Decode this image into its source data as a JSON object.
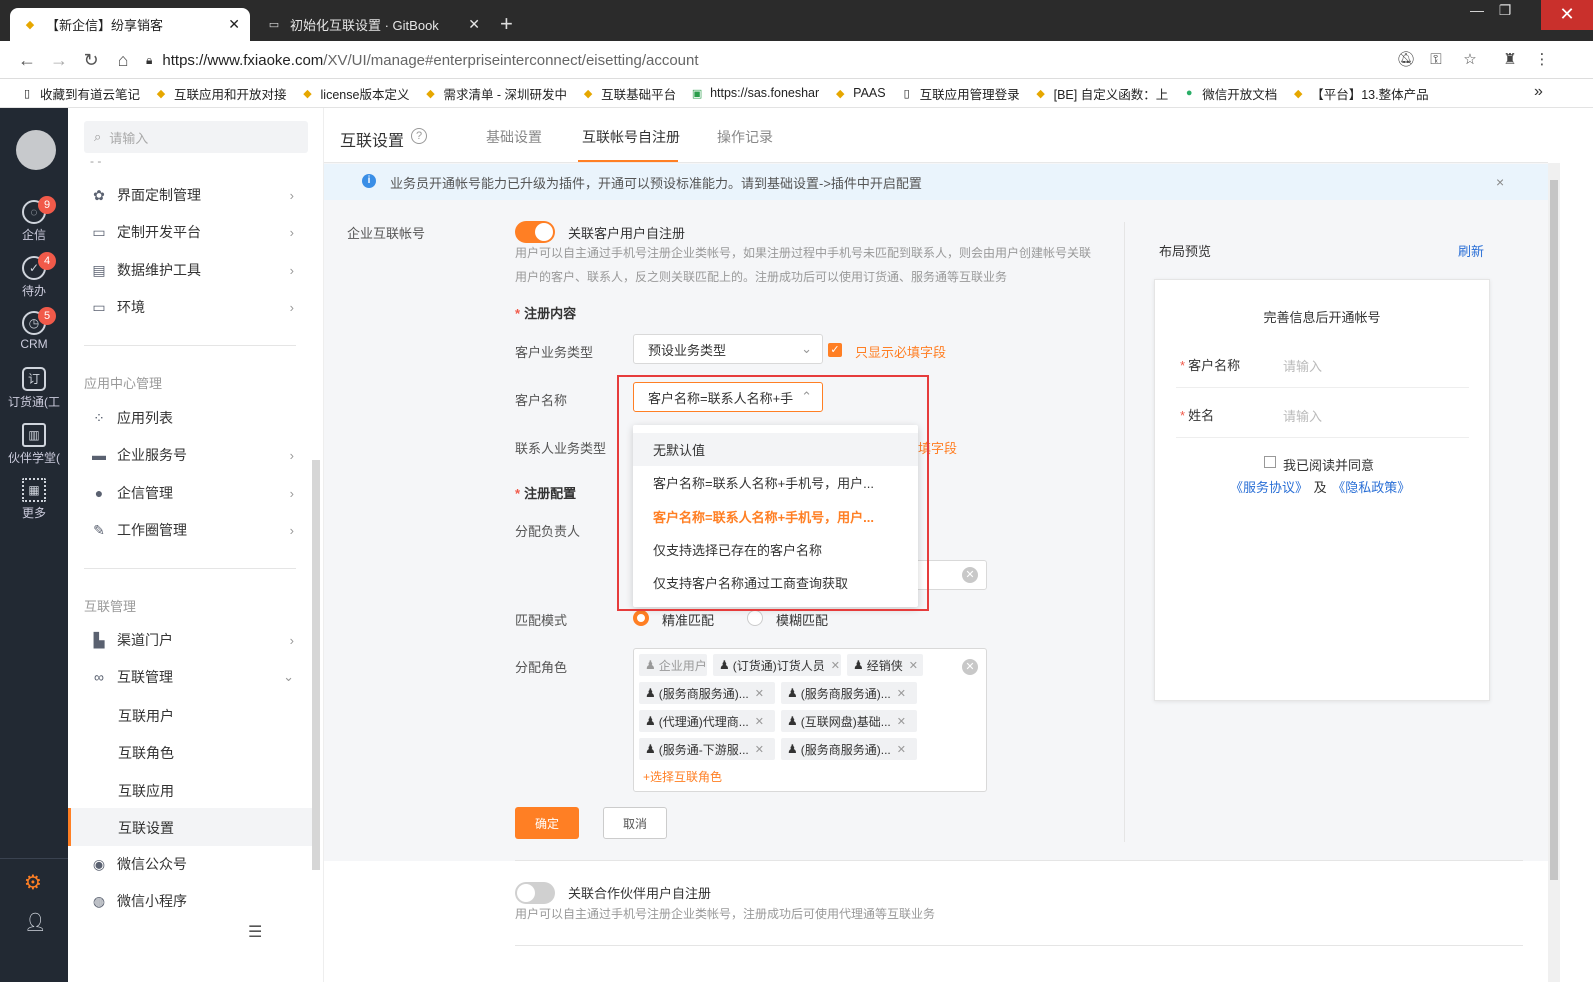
{
  "browser": {
    "tabs": [
      {
        "title": "【新企信】纷享销客",
        "active": true
      },
      {
        "title": "初始化互联设置 · GitBook",
        "active": false
      }
    ],
    "new_tab": "+",
    "url_host": "https://www.fxiaoke.com",
    "url_path": "/XV/UI/manage#enterpriseinterconnect/eisetting/account",
    "bookmarks": [
      "收藏到有道云笔记",
      "互联应用和开放对接",
      "license版本定义",
      "需求清单 - 深圳研发中",
      "互联基础平台",
      "https://sas.foneshar",
      "PAAS",
      "互联应用管理登录",
      "[BE] 自定义函数：上",
      "微信开放文档",
      "【平台】13.整体产品"
    ],
    "more": "»"
  },
  "rail": {
    "items": [
      {
        "label": "企信",
        "badge": "9"
      },
      {
        "label": "待办",
        "badge": "4"
      },
      {
        "label": "CRM",
        "badge": "5"
      },
      {
        "label": "订货通(工",
        "badge": ""
      },
      {
        "label": "伙伴学堂(",
        "badge": ""
      },
      {
        "label": "更多",
        "badge": ""
      }
    ]
  },
  "sidebar": {
    "search_placeholder": "请输入",
    "dash": "- -",
    "group1": [
      "界面定制管理",
      "定制开发平台",
      "数据维护工具",
      "环境"
    ],
    "section_app": "应用中心管理",
    "group2": [
      "应用列表",
      "企业服务号",
      "企信管理",
      "工作圈管理"
    ],
    "section_interconnect": "互联管理",
    "group3": [
      "渠道门户",
      "互联管理"
    ],
    "sub_items": [
      "互联用户",
      "互联角色",
      "互联应用",
      "互联设置"
    ],
    "group4": [
      "微信公众号",
      "微信小程序"
    ]
  },
  "header": {
    "title": "互联设置",
    "help": "?",
    "tabs": [
      "基础设置",
      "互联帐号自注册",
      "操作记录"
    ],
    "active_tab": "互联帐号自注册"
  },
  "notice": {
    "icon": "i",
    "text": "业务员开通帐号能力已升级为插件，开通可以预设标准能力。请到基础设置->插件中开启配置",
    "close": "×"
  },
  "form": {
    "section_label": "企业互联帐号",
    "toggle1_label": "关联客户用户自注册",
    "toggle1_on": true,
    "toggle1_desc1": "用户可以自主通过手机号注册企业类帐号，如果注册过程中手机号未匹配到联系人，则会由用户创建帐号关联",
    "toggle1_desc2": "用户的客户、联系人，反之则关联匹配上的。注册成功后可以使用订货通、服务通等互联业务",
    "reg_content": "注册内容",
    "cust_type_label": "客户业务类型",
    "cust_type_value": "预设业务类型",
    "only_required": "只显示必填字段",
    "cust_name_label": "客户名称",
    "cust_name_value": "客户名称=联系人名称+手",
    "contact_type_label": "联系人业务类型",
    "contact_only_required_tail": "填字段",
    "reg_config": "注册配置",
    "owner_label": "分配负责人",
    "match_label": "匹配模式",
    "match_exact": "精准匹配",
    "match_fuzzy": "模糊匹配",
    "roles_label": "分配角色",
    "roles": [
      "企业用户",
      "(订货通)订货人员",
      "经销侠",
      "(服务商服务通)...",
      "(服务商服务通)...",
      "(代理通)代理商...",
      "(互联网盘)基础...",
      "(服务通-下游服...",
      "(服务商服务通)..."
    ],
    "add_role": "+选择互联角色",
    "confirm": "确定",
    "cancel": "取消",
    "toggle2_label": "关联合作伙伴用户自注册",
    "toggle2_on": false,
    "toggle2_desc": "用户可以自主通过手机号注册企业类帐号，注册成功后可使用代理通等互联业务"
  },
  "dropdown": {
    "options": [
      "无默认值",
      "客户名称=联系人名称+手机号，用户...",
      "客户名称=联系人名称+手机号，用户...",
      "仅支持选择已存在的客户名称",
      "仅支持客户名称通过工商查询获取"
    ],
    "hover_index": 0,
    "selected_index": 2
  },
  "preview": {
    "title": "布局预览",
    "refresh": "刷新",
    "card_title": "完善信息后开通帐号",
    "field1_label": "客户名称",
    "field1_placeholder": "请输入",
    "field2_label": "姓名",
    "field2_placeholder": "请输入",
    "agree": "我已阅读并同意",
    "service": "《服务协议》",
    "and": "及",
    "privacy": "《隐私政策》"
  },
  "colors": {
    "accent": "#ff7f24",
    "rail": "#222933",
    "highlight_box": "#e63c3c",
    "link": "#2a6fd6"
  }
}
